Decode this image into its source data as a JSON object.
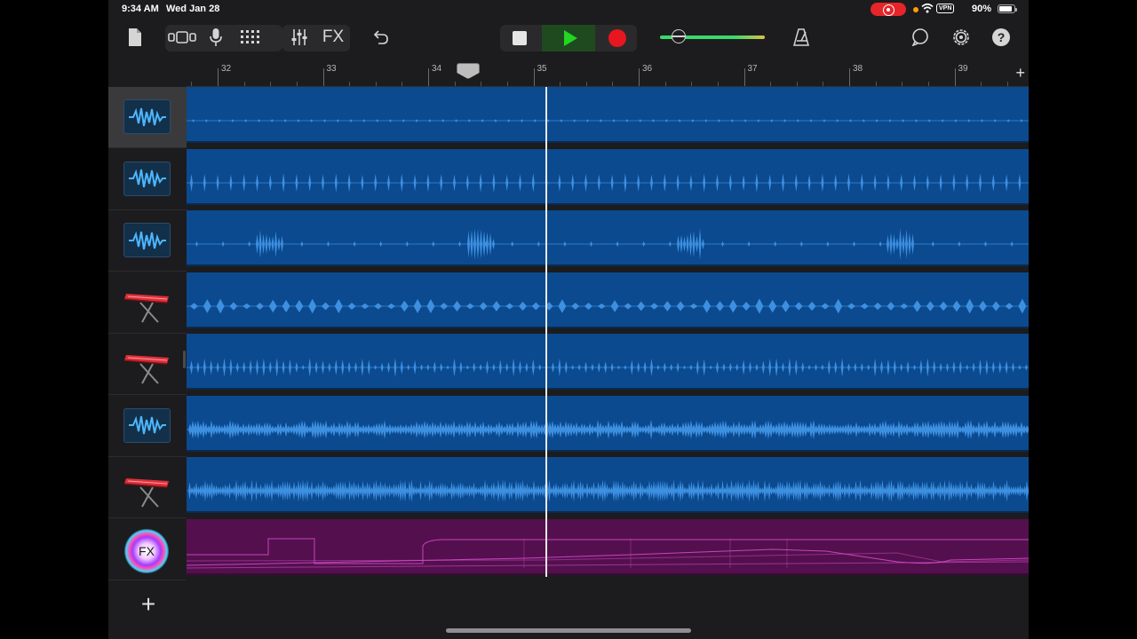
{
  "status_bar": {
    "time": "9:34 AM",
    "date": "Wed Jan 28",
    "vpn_label": "VPN",
    "battery_pct_text": "90%",
    "battery_level": 0.9
  },
  "toolbar": {
    "fx_label": "FX",
    "volume_level": 0.18
  },
  "ruler": {
    "bars": [
      "32",
      "33",
      "34",
      "35",
      "36",
      "37",
      "38",
      "39"
    ],
    "add_label": "+"
  },
  "tracks": [
    {
      "kind": "audio",
      "icon": "waveform-icon",
      "selected": true
    },
    {
      "kind": "audio",
      "icon": "waveform-icon",
      "selected": false
    },
    {
      "kind": "audio",
      "icon": "waveform-icon",
      "selected": false
    },
    {
      "kind": "keyboard",
      "icon": "keyboard-icon",
      "selected": false
    },
    {
      "kind": "keyboard",
      "icon": "keyboard-icon",
      "selected": false
    },
    {
      "kind": "audio",
      "icon": "waveform-icon",
      "selected": false
    },
    {
      "kind": "keyboard",
      "icon": "keyboard-icon",
      "selected": false
    },
    {
      "kind": "fx",
      "icon": "fx-icon",
      "icon_label": "FX",
      "selected": false
    }
  ],
  "add_track_label": "+",
  "colors": {
    "audio_region": "#0b4a8f",
    "waveform": "#3d8fe0",
    "fx_region": "#54104e",
    "automation_line": "#d04bc8",
    "play_green": "#22d622",
    "record_red": "#e8161f"
  }
}
